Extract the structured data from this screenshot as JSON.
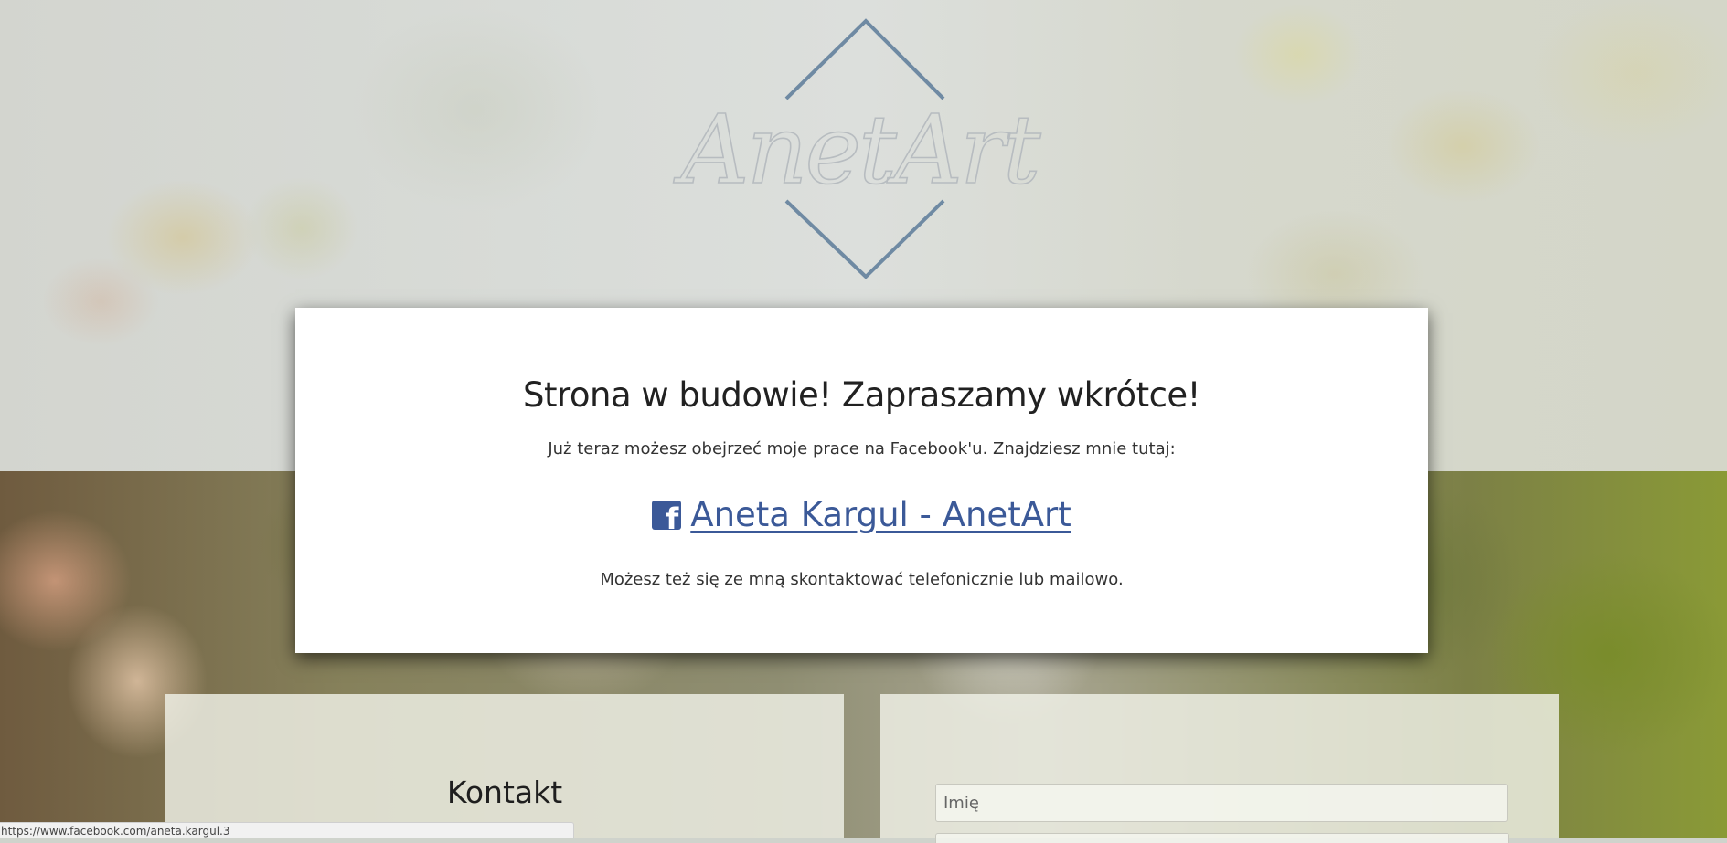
{
  "brand": {
    "logo_text": "AnetArt"
  },
  "notice": {
    "heading": "Strona w budowie! Zapraszamy wkrótce!",
    "intro": "Już teraz możesz obejrzeć moje prace na Facebook'u. Znajdziesz mnie tutaj:",
    "facebook_link_text": " Aneta Kargul - AnetArt",
    "contact_hint": "Możesz też się ze mną skontaktować telefonicznie lub mailowo."
  },
  "contact": {
    "title": "Kontakt"
  },
  "form": {
    "name_placeholder": "Imię"
  },
  "browser": {
    "status_url": "https://www.facebook.com/aneta.kargul.3"
  },
  "colors": {
    "facebook_blue": "#3b5998",
    "logo_line": "#6f8aa3"
  },
  "icons": {
    "facebook": "facebook-icon"
  }
}
